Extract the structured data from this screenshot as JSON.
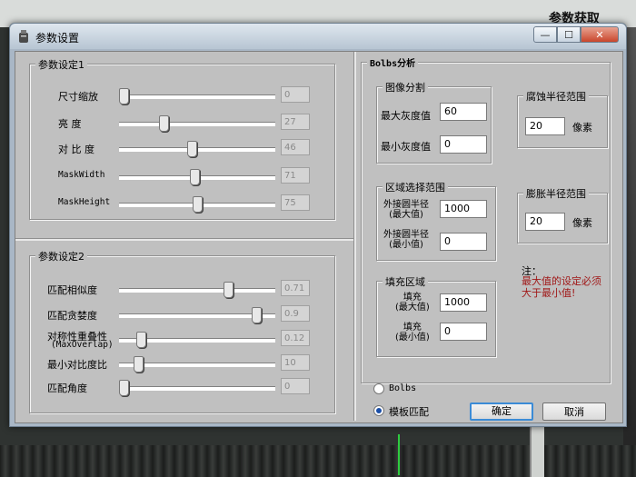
{
  "background": {
    "app_title": "参数获取"
  },
  "window": {
    "title": "参数设置",
    "minimize": "—",
    "maximize": "☐",
    "close": "✕"
  },
  "params1": {
    "legend": "参数设定1",
    "rows": [
      {
        "label": "尺寸缩放",
        "value": "0",
        "level": 0.0
      },
      {
        "label": "亮    度",
        "value": "27",
        "level": 0.27
      },
      {
        "label": "对 比 度",
        "value": "46",
        "level": 0.46
      },
      {
        "label": "MaskWidth",
        "value": "71",
        "level": 0.48
      },
      {
        "label": "MaskHeight",
        "value": "75",
        "level": 0.5
      }
    ]
  },
  "params2": {
    "legend": "参数设定2",
    "rows": [
      {
        "label": "匹配相似度",
        "value": "0.71",
        "level": 0.71
      },
      {
        "label": "匹配贪婪度",
        "value": "0.9",
        "level": 0.9
      },
      {
        "label": "对称性重叠性",
        "label2": "(MaxOverlap)",
        "value": "0.12",
        "level": 0.12
      },
      {
        "label": "最小对比度比",
        "value": "10",
        "level": 0.1
      },
      {
        "label": "匹配角度",
        "value": "0",
        "level": 0.0
      }
    ]
  },
  "blobs": {
    "legend": "Bolbs分析",
    "segmentation": {
      "legend": "图像分割",
      "max_label": "最大灰度值",
      "max_value": "60",
      "min_label": "最小灰度值",
      "min_value": "0"
    },
    "region": {
      "legend": "区域选择范围",
      "max_label1": "外接圆半径",
      "max_label2": "(最大值)",
      "max_value": "1000",
      "min_label1": "外接圆半径",
      "min_label2": "(最小值)",
      "min_value": "0"
    },
    "fill": {
      "legend": "填充区域",
      "max_label1": "填充",
      "max_label2": "(最大值)",
      "max_value": "1000",
      "min_label1": "填充",
      "min_label2": "(最小值)",
      "min_value": "0"
    },
    "erode": {
      "legend": "腐蚀半径范围",
      "value": "20",
      "unit": "像素"
    },
    "dilate": {
      "legend": "膨胀半径范围",
      "value": "20",
      "unit": "像素"
    },
    "note": {
      "title": "注：",
      "line1": "最大值的设定必须",
      "line2": "大于最小值!"
    }
  },
  "mode": {
    "options": [
      {
        "label": "Bolbs",
        "selected": false
      },
      {
        "label": "模板匹配",
        "selected": true
      }
    ]
  },
  "buttons": {
    "ok": "确定",
    "cancel": "取消"
  }
}
